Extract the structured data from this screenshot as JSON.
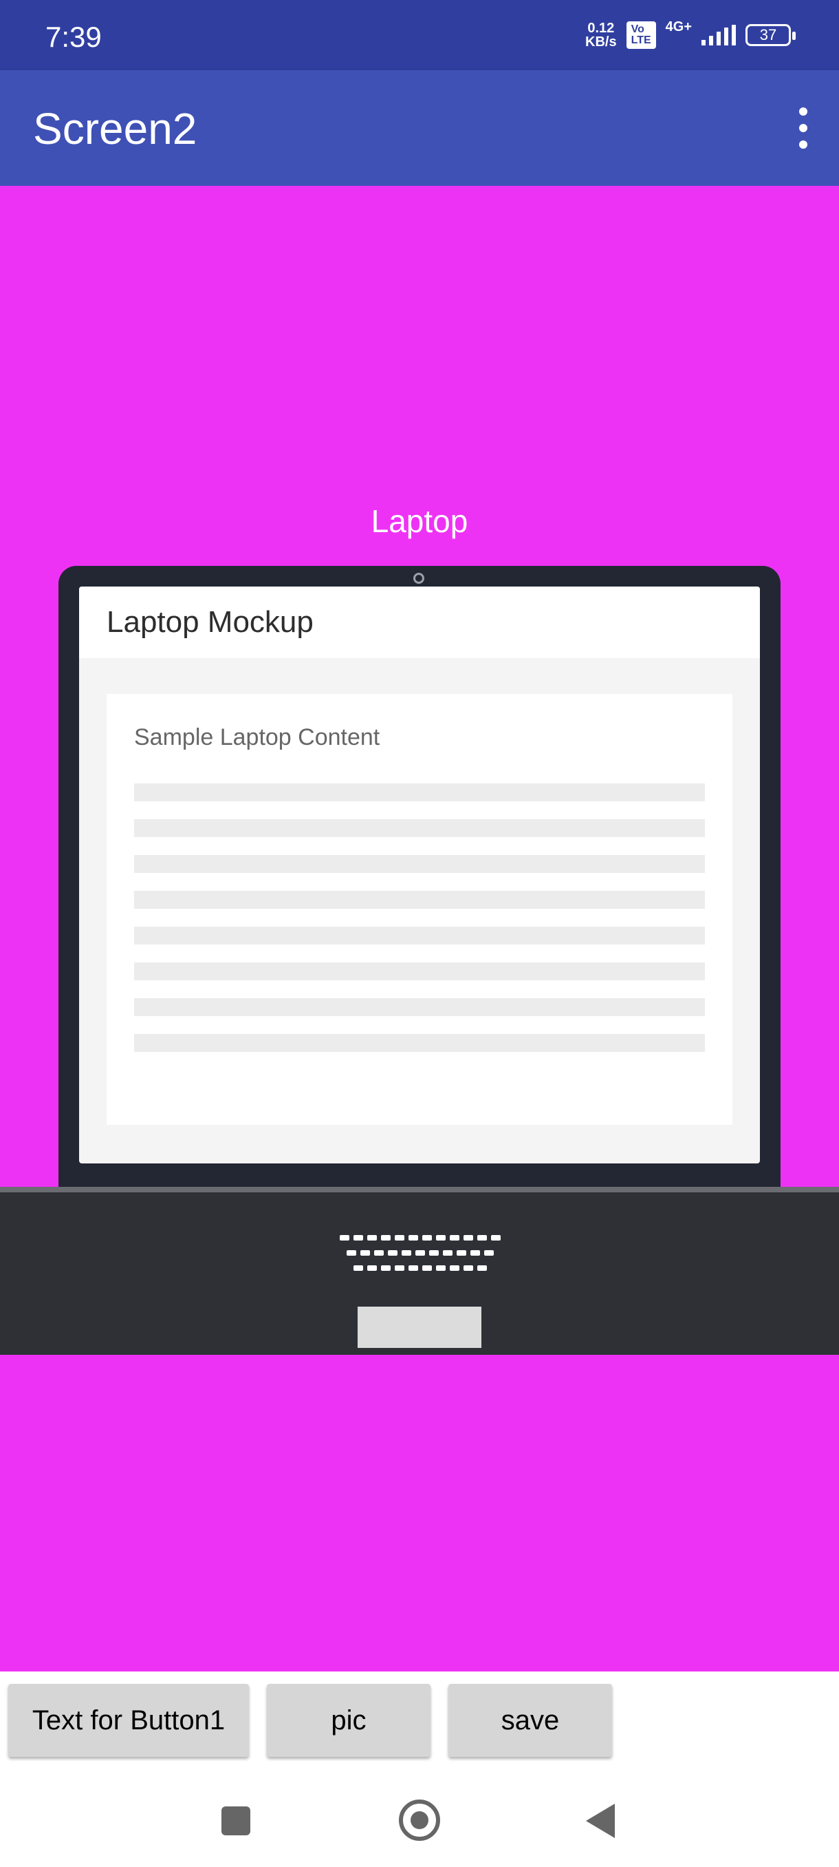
{
  "status_bar": {
    "time": "7:39",
    "net_speed_value": "0.12",
    "net_speed_unit": "KB/s",
    "volte_top": "Vo",
    "volte_bottom": "LTE",
    "network_type": "4G+",
    "battery": "37"
  },
  "app_bar": {
    "title": "Screen2",
    "menu_icon": "overflow-menu-icon"
  },
  "content": {
    "background_color": "#ee32f5",
    "label": "Laptop",
    "laptop": {
      "header_title": "Laptop Mockup",
      "card_title": "Sample Laptop Content",
      "placeholder_lines": 8
    }
  },
  "buttons": {
    "button1_label": "Text for Button1",
    "pic_label": "pic",
    "save_label": "save"
  },
  "colors": {
    "status_bar": "#303f9f",
    "app_bar": "#3f51b5",
    "content": "#ee32f5",
    "button": "#d6d6d6"
  }
}
